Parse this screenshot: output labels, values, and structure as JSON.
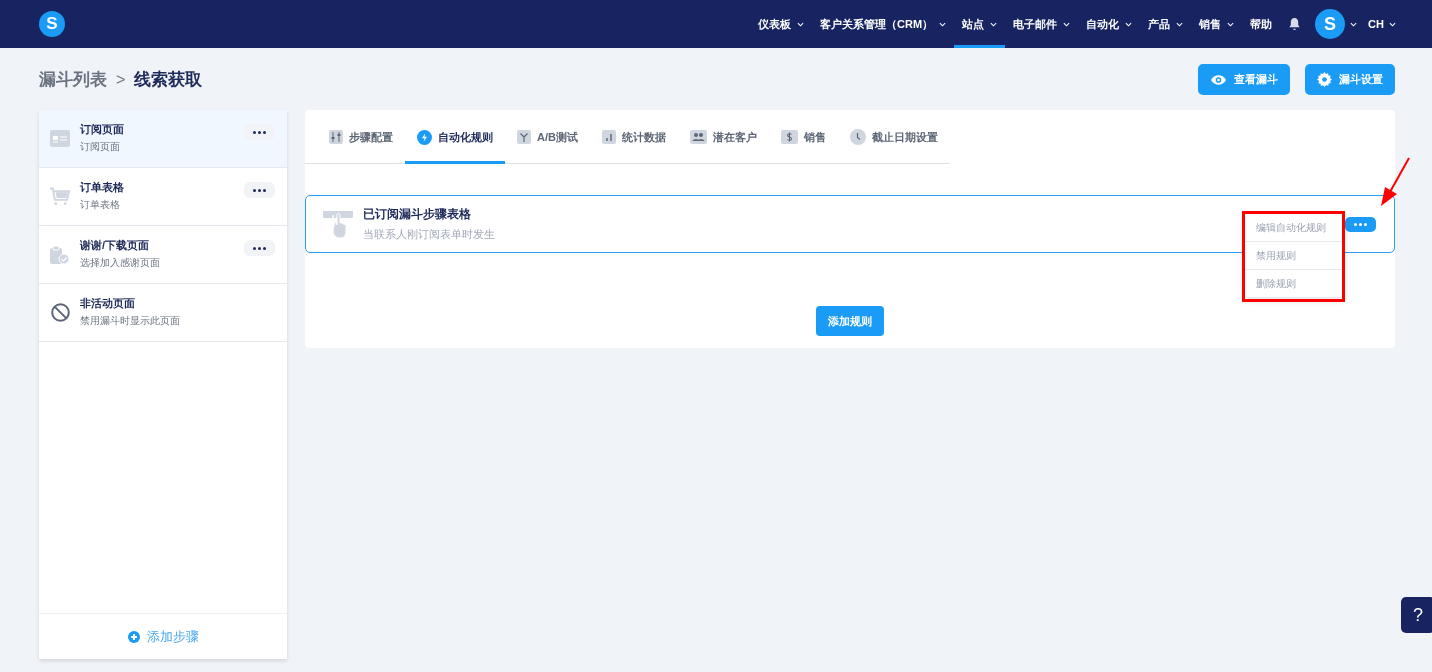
{
  "logo": "S",
  "nav": [
    {
      "label": "仪表板",
      "caret": true,
      "selected": false
    },
    {
      "label": "客户关系管理（CRM）",
      "caret": true,
      "selected": false
    },
    {
      "label": "站点",
      "caret": true,
      "selected": true
    },
    {
      "label": "电子邮件",
      "caret": true,
      "selected": false
    },
    {
      "label": "自动化",
      "caret": true,
      "selected": false
    },
    {
      "label": "产品",
      "caret": true,
      "selected": false
    },
    {
      "label": "销售",
      "caret": true,
      "selected": false
    },
    {
      "label": "帮助",
      "caret": false,
      "selected": false
    }
  ],
  "avatar": "S",
  "language": "CH",
  "breadcrumb": {
    "parent": "漏斗列表",
    "separator": ">",
    "current": "线索获取"
  },
  "header_buttons": [
    {
      "label": "查看漏斗",
      "kind": "view"
    },
    {
      "label": "漏斗设置",
      "kind": "settings"
    }
  ],
  "steps": [
    {
      "title": "订阅页面",
      "subtitle": "订阅页面",
      "selected": true,
      "menu": true
    },
    {
      "title": "订单表格",
      "subtitle": "订单表格",
      "selected": false,
      "menu": true
    },
    {
      "title": "谢谢/下载页面",
      "subtitle": "选择加入感谢页面",
      "selected": false,
      "menu": true
    },
    {
      "title": "非活动页面",
      "subtitle": "禁用漏斗时显示此页面",
      "selected": false,
      "menu": false
    }
  ],
  "add_step": "添加步骤",
  "tabs": [
    {
      "label": "步骤配置",
      "selected": false
    },
    {
      "label": "自动化规则",
      "selected": true
    },
    {
      "label": "A/B测试",
      "selected": false
    },
    {
      "label": "统计数据",
      "selected": false
    },
    {
      "label": "潜在客户",
      "selected": false
    },
    {
      "label": "销售",
      "selected": false
    },
    {
      "label": "截止日期设置",
      "selected": false
    }
  ],
  "rule": {
    "title": "已订阅漏斗步骤表格",
    "description": "当联系人刚订阅表单时发生",
    "menu_open": true,
    "menu": [
      "编辑自动化规则",
      "禁用规则",
      "删除规则"
    ]
  },
  "add_rule": "添加规则",
  "help": "?"
}
